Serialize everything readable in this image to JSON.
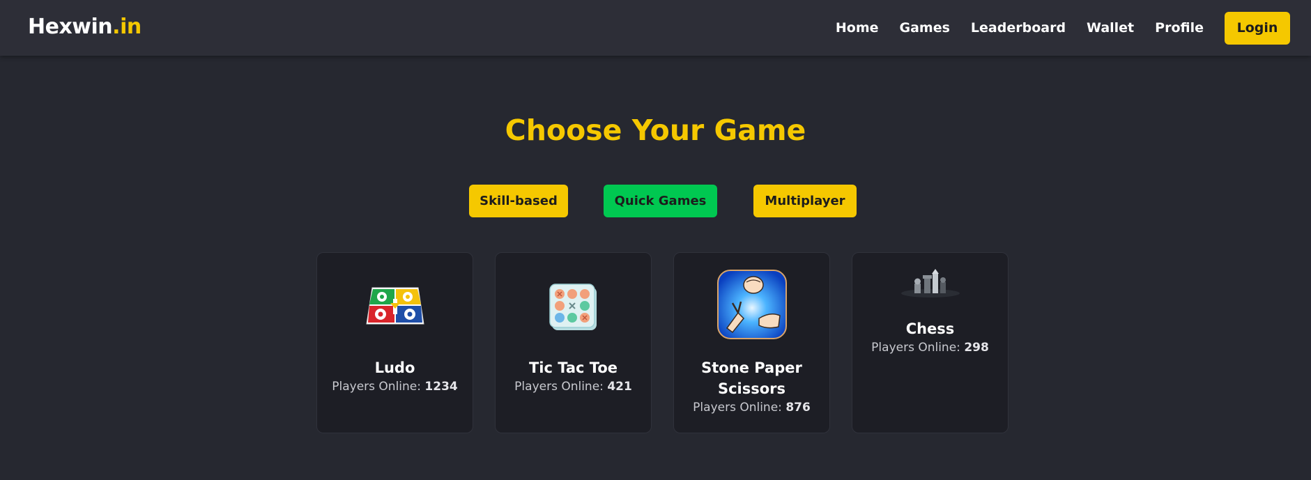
{
  "brand": {
    "name": "Hexwin",
    "suffix": ".in"
  },
  "nav": {
    "links": [
      "Home",
      "Games",
      "Leaderboard",
      "Wallet",
      "Profile"
    ],
    "login_label": "Login"
  },
  "main": {
    "heading": "Choose Your Game",
    "filters": [
      {
        "label": "Skill-based",
        "color": "#f5c800"
      },
      {
        "label": "Quick Games",
        "color": "#00c851"
      },
      {
        "label": "Multiplayer",
        "color": "#f5c800"
      }
    ],
    "players_label": "Players Online:",
    "games": [
      {
        "title": "Ludo",
        "players": "1234",
        "icon": "ludo-board-icon"
      },
      {
        "title": "Tic Tac Toe",
        "players": "421",
        "icon": "tic-tac-toe-icon"
      },
      {
        "title": "Stone Paper Scissors",
        "players": "876",
        "icon": "rock-paper-scissors-icon"
      },
      {
        "title": "Chess",
        "players": "298",
        "icon": "chess-pieces-icon"
      }
    ]
  },
  "colors": {
    "accent": "#f5c800",
    "green": "#00c851",
    "background": "#262830",
    "navbar": "#2d2e37",
    "card": "#1d1e25"
  }
}
